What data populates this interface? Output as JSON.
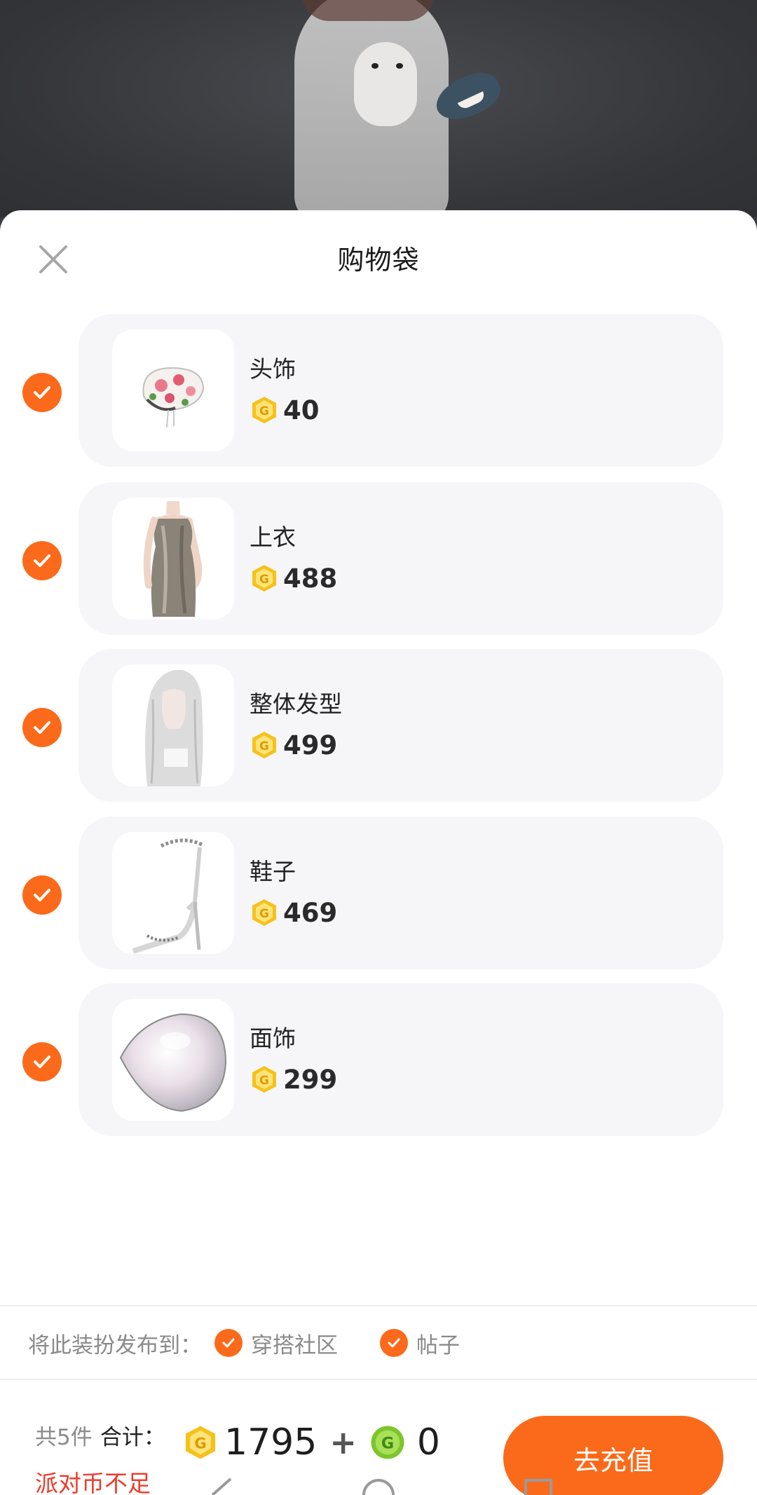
{
  "sheet": {
    "title": "购物袋"
  },
  "items": [
    {
      "name": "头饰",
      "price": "40",
      "checked": true,
      "icon": "headwear-image"
    },
    {
      "name": "上衣",
      "price": "488",
      "checked": true,
      "icon": "top-image"
    },
    {
      "name": "整体发型",
      "price": "499",
      "checked": true,
      "icon": "hairstyle-image"
    },
    {
      "name": "鞋子",
      "price": "469",
      "checked": true,
      "icon": "shoes-image"
    },
    {
      "name": "面饰",
      "price": "299",
      "checked": true,
      "icon": "face-accessory-image"
    }
  ],
  "publish": {
    "label": "将此装扮发布到：",
    "options": [
      {
        "label": "穿搭社区",
        "checked": true
      },
      {
        "label": "帖子",
        "checked": true
      }
    ]
  },
  "footer": {
    "count_text": "共5件",
    "total_label": "合计：",
    "total_coins": "1795",
    "plus": "+",
    "green_coins": "0",
    "warning": "派对币不足",
    "recharge_label": "去充值"
  },
  "colors": {
    "accent": "#fb6a1a",
    "warning": "#ee3a2a",
    "coin_gold": "#f7c11b",
    "coin_green": "#7cc62b"
  }
}
